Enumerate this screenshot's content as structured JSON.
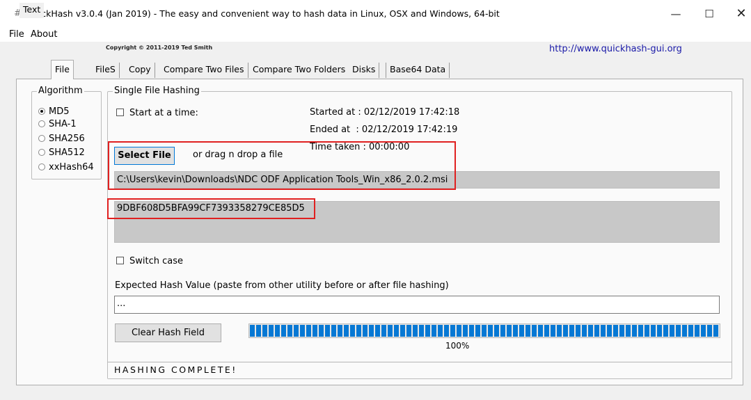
{
  "window": {
    "title": "QuickHash v3.0.4 (Jan 2019) - The easy and convenient way to hash data in Linux, OSX and Windows, 64-bit",
    "app_icon": "#",
    "minimize_glyph": "—",
    "maximize_glyph": "☐",
    "close_glyph": "✕"
  },
  "menu": {
    "file": "File",
    "about": "About"
  },
  "header": {
    "copyright": "Copyright © 2011-2019 Ted Smith",
    "website": "http://www.quickhash-gui.org"
  },
  "tabs": [
    {
      "label": "Text",
      "active": false
    },
    {
      "label": "File",
      "active": true
    },
    {
      "label": "FileS",
      "active": false
    },
    {
      "label": "Copy",
      "active": false
    },
    {
      "label": "Compare Two Files",
      "active": false
    },
    {
      "label": "Compare Two Folders",
      "active": false
    },
    {
      "label": "Disks",
      "active": false
    },
    {
      "label": "Base64 Data",
      "active": false
    }
  ],
  "algorithm": {
    "legend": "Algorithm",
    "options": [
      {
        "label": "MD5",
        "selected": true
      },
      {
        "label": "SHA-1",
        "selected": false
      },
      {
        "label": "SHA256",
        "selected": false
      },
      {
        "label": "SHA512",
        "selected": false
      },
      {
        "label": "xxHash64",
        "selected": false
      }
    ]
  },
  "single": {
    "legend": "Single File Hashing",
    "start_at_time_label": "Start at a time:",
    "started_at": "Started at : 02/12/2019 17:42:18",
    "ended_at": "Ended at  : 02/12/2019 17:42:19",
    "time_taken": "Time taken : 00:00:00",
    "select_file_label": "Select File",
    "drag_drop_text": "or drag n drop a file",
    "file_path": "C:\\Users\\kevin\\Downloads\\NDC ODF Application Tools_Win_x86_2.0.2.msi",
    "hash_value": "9DBF608D5BFA99CF7393358279CE85D5",
    "switch_case_label": "Switch case",
    "expected_label": "Expected Hash Value (paste from other utility before or after file hashing)",
    "expected_value": "...",
    "clear_button_label": "Clear Hash Field",
    "progress_percent": 100,
    "progress_label": "100%",
    "status": "HASHING COMPLETE!"
  },
  "colors": {
    "highlight": "#e02020",
    "progress": "#0678d4",
    "link": "#1a1aa8"
  }
}
